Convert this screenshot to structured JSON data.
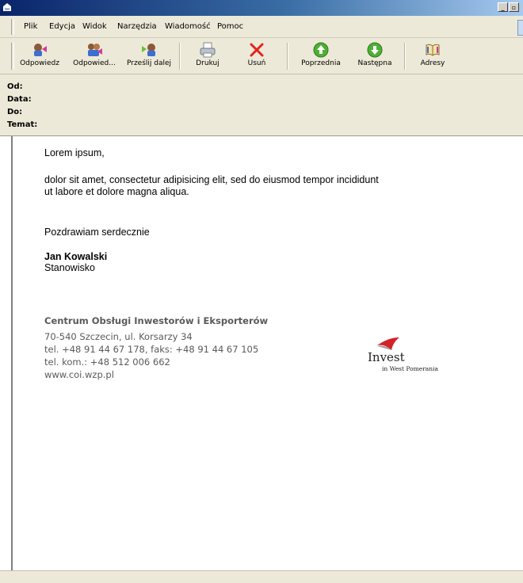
{
  "menu": {
    "items": [
      "Plik",
      "Edycja",
      "Widok",
      "Narzędzia",
      "Wiadomość",
      "Pomoc"
    ]
  },
  "toolbar": {
    "buttons": [
      {
        "label": "Odpowiedz",
        "icon": "reply-icon"
      },
      {
        "label": "Odpowied...",
        "icon": "reply-all-icon"
      },
      {
        "label": "Prześlij dalej",
        "icon": "forward-icon"
      },
      {
        "label": "Drukuj",
        "icon": "printer-icon"
      },
      {
        "label": "Usuń",
        "icon": "delete-icon"
      },
      {
        "label": "Poprzednia",
        "icon": "previous-icon"
      },
      {
        "label": "Następna",
        "icon": "next-icon"
      },
      {
        "label": "Adresy",
        "icon": "address-book-icon"
      }
    ]
  },
  "headers": {
    "from_label": "Od:",
    "date_label": "Data:",
    "to_label": "Do:",
    "subject_label": "Temat:"
  },
  "message": {
    "greeting": "Lorem ipsum,",
    "body_line1": "dolor sit amet, consectetur adipisicing elit, sed do eiusmod tempor incididunt",
    "body_line2": "ut labore et dolore magna aliqua.",
    "closing": "Pozdrawiam serdecznie",
    "sender_name": "Jan Kowalski",
    "sender_position": "Stanowisko"
  },
  "signature": {
    "company": "Centrum Obsługi Inwestorów i Eksporterów",
    "address": "70-540 Szczecin, ul. Korsarzy 34",
    "phones": "tel. +48 91 44 67 178, faks: +48 91 44 67 105",
    "mobile": "tel. kom.: +48 512 006 662",
    "website": "www.coi.wzp.pl",
    "logo_main": "Invest",
    "logo_sub": "in West Pomerania"
  },
  "colors": {
    "titlebar_start": "#0a246a",
    "chrome_bg": "#ece9d8",
    "signature_text": "#5a5a5a",
    "logo_red": "#d2232a"
  }
}
